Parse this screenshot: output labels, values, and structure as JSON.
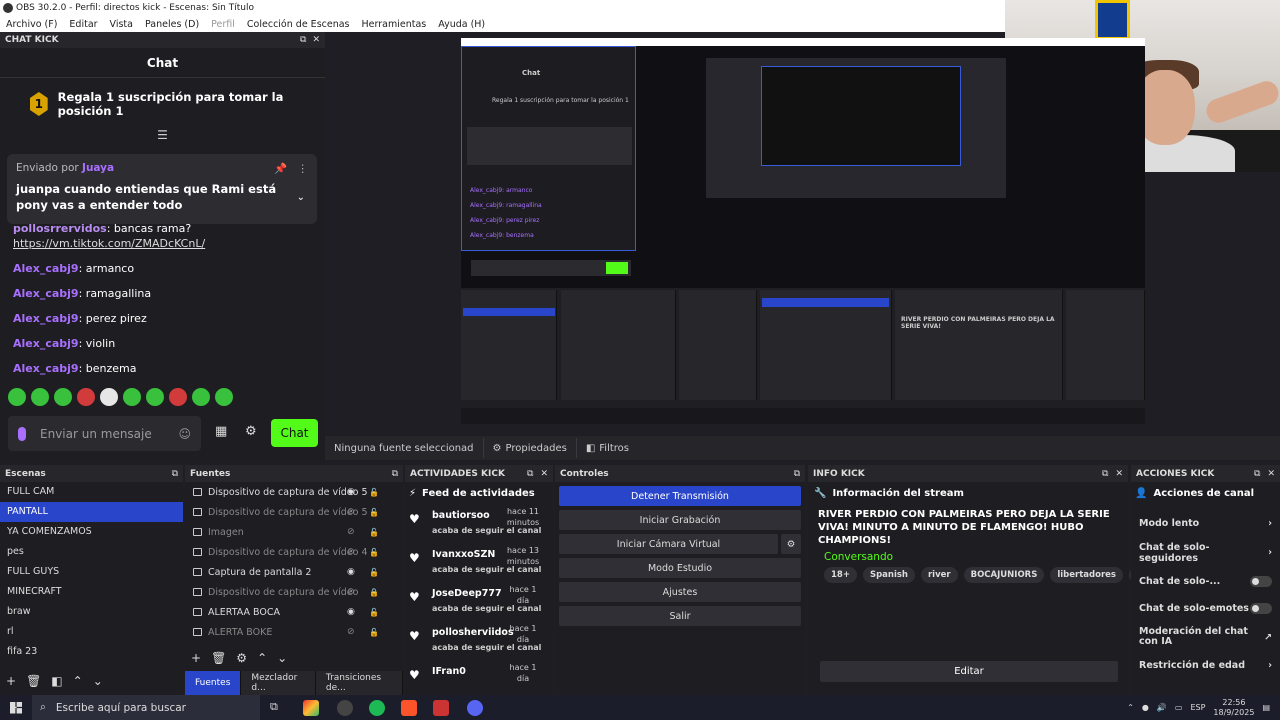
{
  "window": {
    "title": "OBS 30.2.0 - Perfil: directos kick - Escenas: Sin Título"
  },
  "menu": [
    "Archivo (F)",
    "Editar",
    "Vista",
    "Paneles (D)",
    "Perfil",
    "Colección de Escenas",
    "Herramientas",
    "Ayuda (H)"
  ],
  "chat": {
    "dock_title": "CHAT KICK",
    "header": "Chat",
    "goal_rank": "1",
    "goal_text": "Regala 1 suscripción para tomar la posición 1",
    "pinned": {
      "sent_by": "Enviado por",
      "user": "Juaya",
      "message": "juanpa cuando entiendas que Rami está pony vas a entender todo"
    },
    "messages": [
      {
        "user": "pollosrrervidos",
        "text": ": bancas rama?"
      },
      {
        "user": "",
        "text": "https://vm.tiktok.com/ZMADcKCnL/"
      },
      {
        "user": "Alex_cabj9",
        "text": ": armanco"
      },
      {
        "user": "Alex_cabj9",
        "text": ": ramagallina"
      },
      {
        "user": "Alex_cabj9",
        "text": ": perez pirez"
      },
      {
        "user": "Alex_cabj9",
        "text": ": violin"
      },
      {
        "user": "Alex_cabj9",
        "text": ": benzema"
      }
    ],
    "input_placeholder": "Enviar un mensaje",
    "send_label": "Chat"
  },
  "propsbar": {
    "no_source": "Ninguna fuente seleccionad",
    "properties": "Propiedades",
    "filters": "Filtros"
  },
  "scenes": {
    "title": "Escenas",
    "items": [
      "FULL CAM",
      "PANTALL",
      "YA COMENZAMOS",
      "pes",
      "FULL GUYS",
      "MINECRAFT",
      "braw",
      "rl",
      "fifa 23"
    ],
    "selected": 1
  },
  "sources": {
    "title": "Fuentes",
    "items": [
      {
        "name": "Dispositivo de captura de vídeo 5",
        "visible": true,
        "locked": false
      },
      {
        "name": "Dispositivo de captura de vídeo 5",
        "visible": false,
        "locked": false
      },
      {
        "name": "Imagen",
        "visible": false,
        "locked": false
      },
      {
        "name": "Dispositivo de captura de vídeo 4",
        "visible": false,
        "locked": false
      },
      {
        "name": "Captura de pantalla 2",
        "visible": true,
        "locked": false
      },
      {
        "name": "Dispositivo de captura de vídeo",
        "visible": false,
        "locked": true
      },
      {
        "name": "ALERTAA BOCA",
        "visible": true,
        "locked": false
      },
      {
        "name": "ALERTA BOKE",
        "visible": false,
        "locked": false
      }
    ],
    "tabs": [
      "Fuentes",
      "Mezclador d...",
      "Transiciones de..."
    ]
  },
  "activity": {
    "title": "ACTIVIDADES KICK",
    "feed_title": "Feed de actividades",
    "items": [
      {
        "name": "bautiorsoo",
        "time": "hace 11 minutos",
        "action": "acaba de seguir el canal"
      },
      {
        "name": "IvanxxoSZN",
        "time": "hace 13 minutos",
        "action": "acaba de seguir el canal"
      },
      {
        "name": "JoseDeep777",
        "time": "hace 1 día",
        "action": "acaba de seguir el canal"
      },
      {
        "name": "pollosherviidos",
        "time": "hace 1 día",
        "action": "acaba de seguir el canal"
      },
      {
        "name": "IFran0",
        "time": "hace 1 día",
        "action": ""
      }
    ]
  },
  "controls": {
    "title": "Controles",
    "buttons": [
      "Detener Transmisión",
      "Iniciar Grabación",
      "Iniciar Cámara Virtual",
      "Modo Estudio",
      "Ajustes",
      "Salir"
    ]
  },
  "info": {
    "title": "INFO KICK",
    "section": "Información del stream",
    "stream_title": "RIVER PERDIO CON PALMEIRAS PERO DEJA LA SERIE VIVA! MINUTO A MINUTO DE FLAMENGO! HUBO CHAMPIONS!",
    "category": "Conversando",
    "tags": [
      "18+",
      "Spanish",
      "river",
      "BOCAJUNIORS",
      "libertadores",
      "ligaa"
    ],
    "edit": "Editar"
  },
  "actions": {
    "title": "ACCIONES KICK",
    "section": "Acciones de canal",
    "items": [
      {
        "label": "Modo lento",
        "control": "arrow"
      },
      {
        "label": "Chat de solo-seguidores",
        "control": "arrow"
      },
      {
        "label": "Chat de solo-...",
        "control": "toggle"
      },
      {
        "label": "Chat de solo-emotes",
        "control": "toggle"
      },
      {
        "label": "Moderación del chat con IA",
        "control": "link"
      },
      {
        "label": "Restricción de edad",
        "control": "arrow"
      }
    ]
  },
  "taskbar": {
    "search": "Escribe aquí para buscar",
    "lang": "ESP",
    "time": "22:56",
    "date": "18/9/2025"
  },
  "colors": {
    "kick_green": "#53fc18",
    "accent_blue": "#2945c9",
    "username_purple": "#a970ff"
  }
}
